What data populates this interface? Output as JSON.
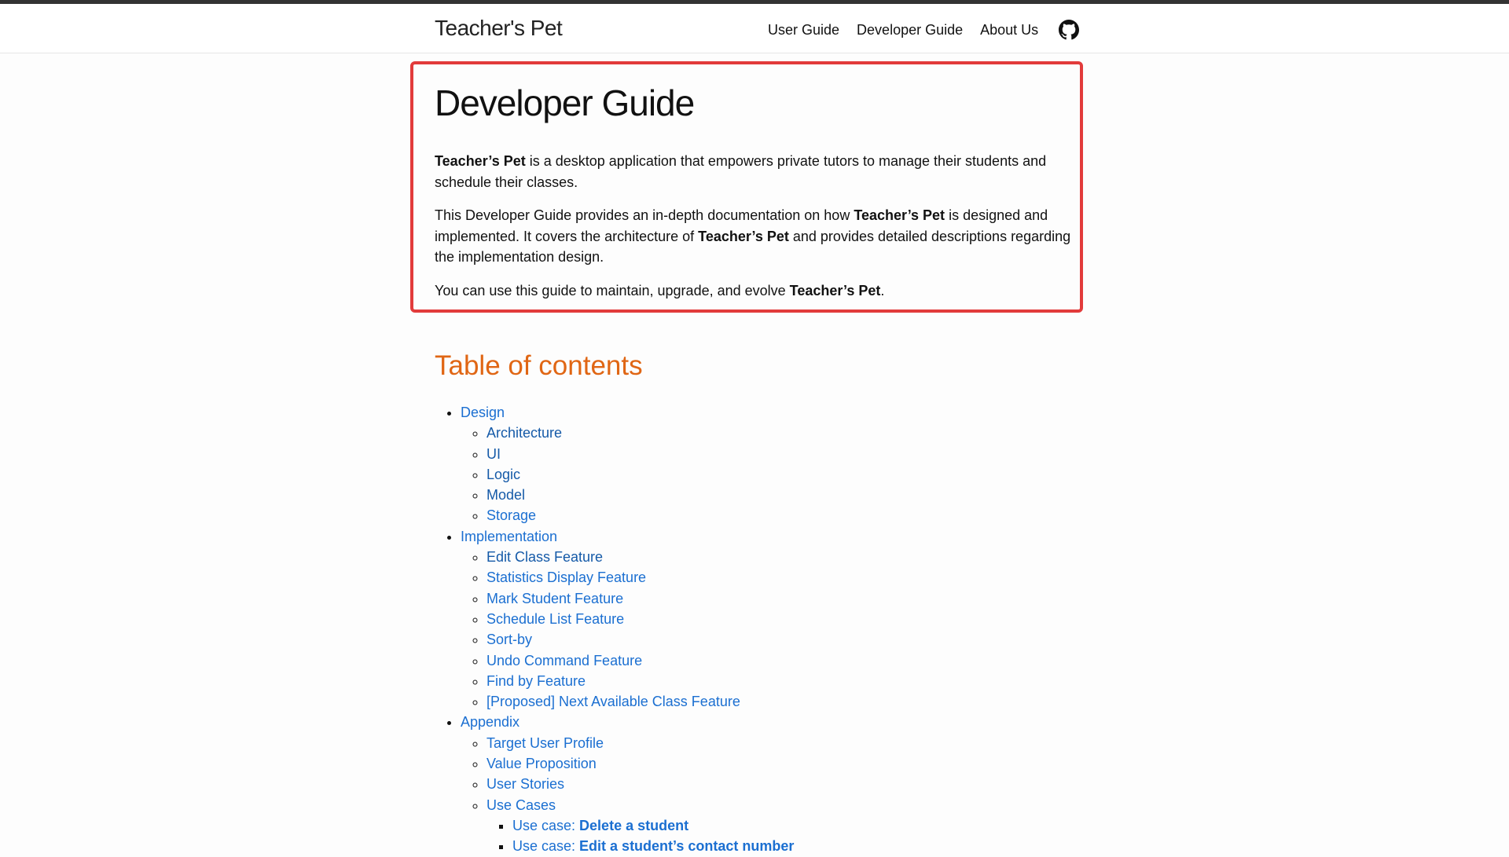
{
  "header": {
    "brand": "Teacher's Pet",
    "nav": [
      "User Guide",
      "Developer Guide",
      "About Us"
    ],
    "github_icon": "github-icon"
  },
  "main": {
    "title": "Developer Guide",
    "intro": {
      "p1_bold": "Teacher’s Pet",
      "p1_rest": " is a desktop application that empowers private tutors to manage their students and schedule their classes.",
      "p2_a": "This Developer Guide provides an in-depth documentation on how ",
      "p2_b": "Teacher’s Pet",
      "p2_c": " is designed and implemented. It covers the architecture of ",
      "p2_d": "Teacher’s Pet",
      "p2_e": " and provides detailed descriptions regarding the implementation design.",
      "p3_a": "You can use this guide to maintain, upgrade, and evolve ",
      "p3_b": "Teacher’s Pet",
      "p3_c": "."
    },
    "toc_title": "Table of contents",
    "toc": {
      "design": "Design",
      "design_items": [
        "Architecture",
        "UI",
        "Logic",
        "Model",
        "Storage"
      ],
      "implementation": "Implementation",
      "implementation_items": [
        "Edit Class Feature",
        "Statistics Display Feature",
        "Mark Student Feature",
        "Schedule List Feature",
        "Sort-by",
        "Undo Command Feature",
        "Find by Feature",
        "[Proposed] Next Available Class Feature"
      ],
      "appendix": "Appendix",
      "appendix_items": [
        "Target User Profile",
        "Value Proposition",
        "User Stories",
        "Use Cases"
      ],
      "use_cases": [
        {
          "prefix": "Use case: ",
          "name": "Delete a student"
        },
        {
          "prefix": "Use case: ",
          "name": "Edit a student’s contact number"
        }
      ]
    }
  },
  "colors": {
    "link": "#1b6fd1",
    "toc_title": "#e06614",
    "highlight": "#e23b3b",
    "top_stripe": "#333333"
  }
}
